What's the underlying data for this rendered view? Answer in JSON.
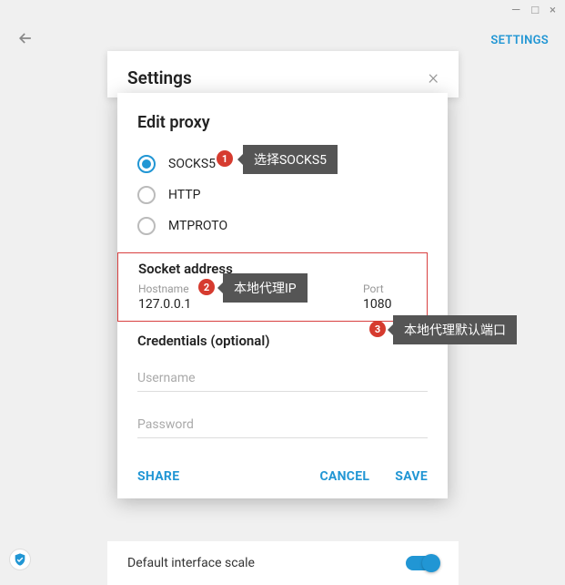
{
  "window": {
    "min": "—",
    "max": "□",
    "close": "×"
  },
  "topbar": {
    "settings": "SETTINGS"
  },
  "settingsPanel": {
    "title": "Settings"
  },
  "modal": {
    "title": "Edit proxy",
    "protocols": {
      "socks5": "SOCKS5",
      "http": "HTTP",
      "mtproto": "MTPROTO"
    },
    "socket": {
      "heading": "Socket address",
      "host_label": "Hostname",
      "host_value": "127.0.0.1",
      "port_label": "Port",
      "port_value": "1080"
    },
    "credentials": {
      "heading": "Credentials (optional)",
      "username_placeholder": "Username",
      "password_placeholder": "Password"
    },
    "actions": {
      "share": "SHARE",
      "cancel": "CANCEL",
      "save": "SAVE"
    }
  },
  "bottom": {
    "scale_label": "Default interface scale"
  },
  "annotations": {
    "b1": "1",
    "b2": "2",
    "b3": "3",
    "t1": "选择SOCKS5",
    "t2": "本地代理IP",
    "t3": "本地代理默认端口"
  }
}
